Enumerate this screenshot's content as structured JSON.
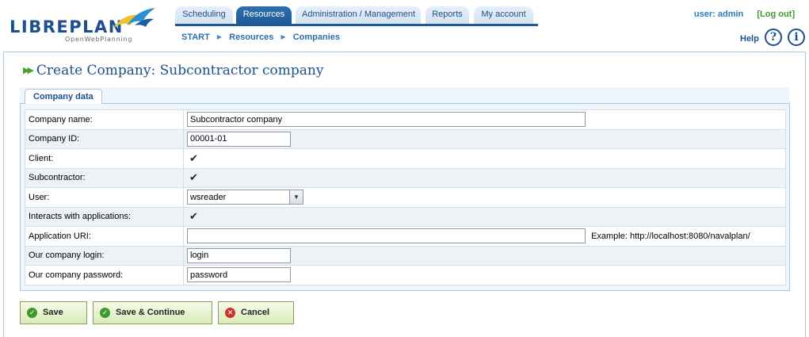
{
  "header": {
    "logo_text": "LIBREPLAN",
    "logo_sub": "OpenWebPlanning",
    "tabs": [
      {
        "label": "Scheduling"
      },
      {
        "label": "Resources"
      },
      {
        "label": "Administration / Management"
      },
      {
        "label": "Reports"
      },
      {
        "label": "My account"
      }
    ],
    "active_tab": "Resources",
    "user_label": "user: admin",
    "logout_label": "[Log out]",
    "breadcrumb": [
      "START",
      "Resources",
      "Companies"
    ],
    "help_label": "Help"
  },
  "page": {
    "title": "Create Company: Subcontractor company",
    "panel_tab": "Company data"
  },
  "form": {
    "company_name": {
      "label": "Company name:",
      "value": "Subcontractor company"
    },
    "company_id": {
      "label": "Company ID:",
      "value": "00001-01"
    },
    "client": {
      "label": "Client:",
      "checked": true
    },
    "subcontractor": {
      "label": "Subcontractor:",
      "checked": true
    },
    "user": {
      "label": "User:",
      "value": "wsreader"
    },
    "interacts": {
      "label": "Interacts with applications:",
      "checked": true
    },
    "app_uri": {
      "label": "Application URI:",
      "value": "",
      "example": "Example: http://localhost:8080/navalplan/"
    },
    "login": {
      "label": "Our company login:",
      "value": "login"
    },
    "password": {
      "label": "Our company password:",
      "value": "password"
    }
  },
  "buttons": {
    "save": "Save",
    "save_continue": "Save & Continue",
    "cancel": "Cancel"
  },
  "colors": {
    "brand": "#1c4f8d",
    "accent": "#2a7cbd",
    "logout": "#3f9b2e"
  }
}
